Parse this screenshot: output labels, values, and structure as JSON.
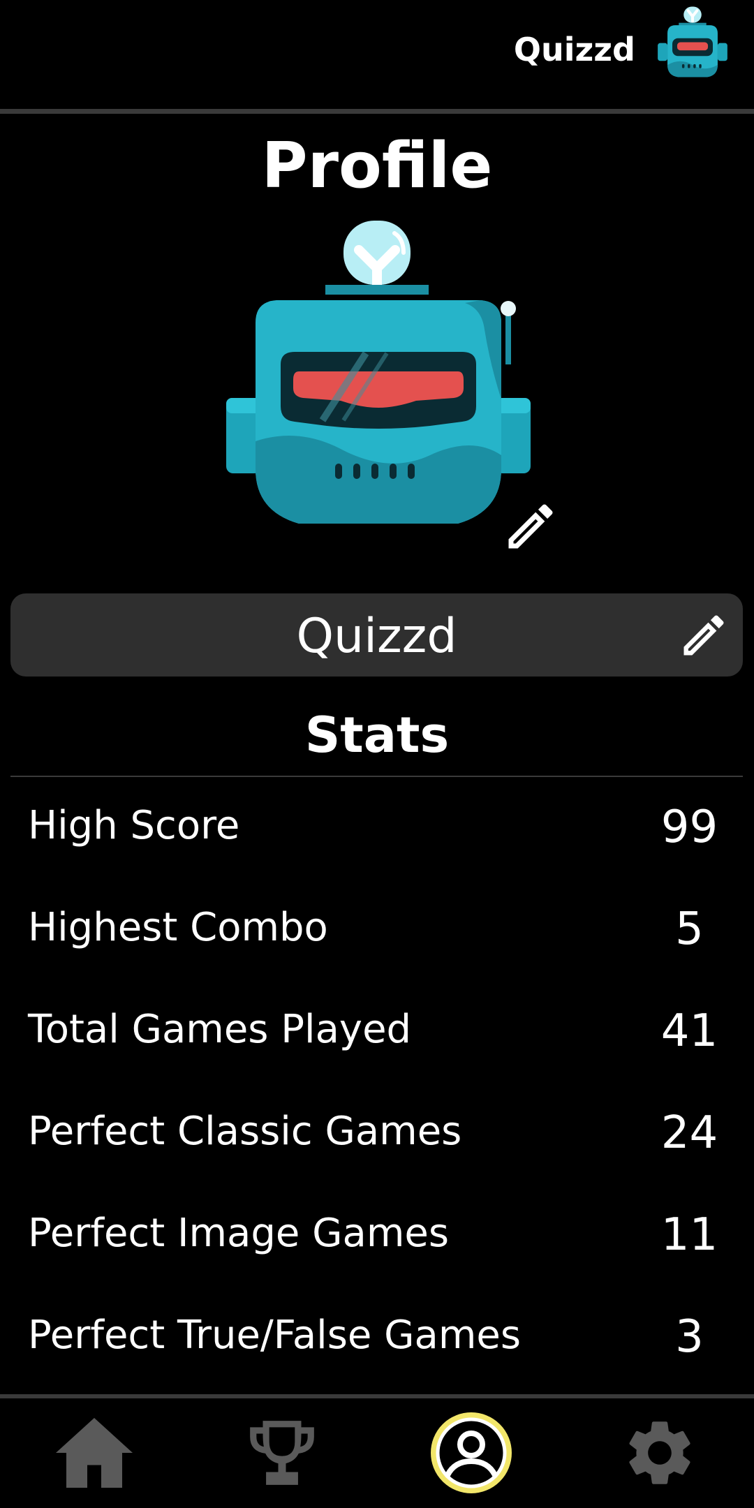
{
  "header": {
    "username": "Quizzd",
    "avatar_icon": "robot-avatar-icon"
  },
  "profile": {
    "title": "Profile",
    "avatar_icon": "robot-avatar-icon",
    "edit_avatar_icon": "pencil-icon",
    "name": "Quizzd",
    "edit_name_icon": "pencil-icon"
  },
  "stats": {
    "title": "Stats",
    "items": [
      {
        "label": "High Score",
        "value": "99"
      },
      {
        "label": "Highest Combo",
        "value": "5"
      },
      {
        "label": "Total Games Played",
        "value": "41"
      },
      {
        "label": "Perfect Classic Games",
        "value": "24"
      },
      {
        "label": "Perfect Image Games",
        "value": "11"
      },
      {
        "label": "Perfect True/False Games",
        "value": "3"
      }
    ]
  },
  "nav": {
    "items": [
      {
        "icon": "home-icon",
        "active": false
      },
      {
        "icon": "trophy-icon",
        "active": false
      },
      {
        "icon": "profile-icon",
        "active": true
      },
      {
        "icon": "gear-icon",
        "active": false
      }
    ]
  },
  "colors": {
    "background": "#000000",
    "text": "#ffffff",
    "panel": "#2f2f2f",
    "divider": "#3a3a3a",
    "nav_inactive": "#5a5a5a",
    "nav_active_ring": "#f2e66a",
    "robot_body": "#26b4c9",
    "robot_dark": "#1b8fa3",
    "robot_visor": "#0a2b33",
    "robot_light": "#e4514f",
    "robot_dome": "#b8eef5"
  }
}
